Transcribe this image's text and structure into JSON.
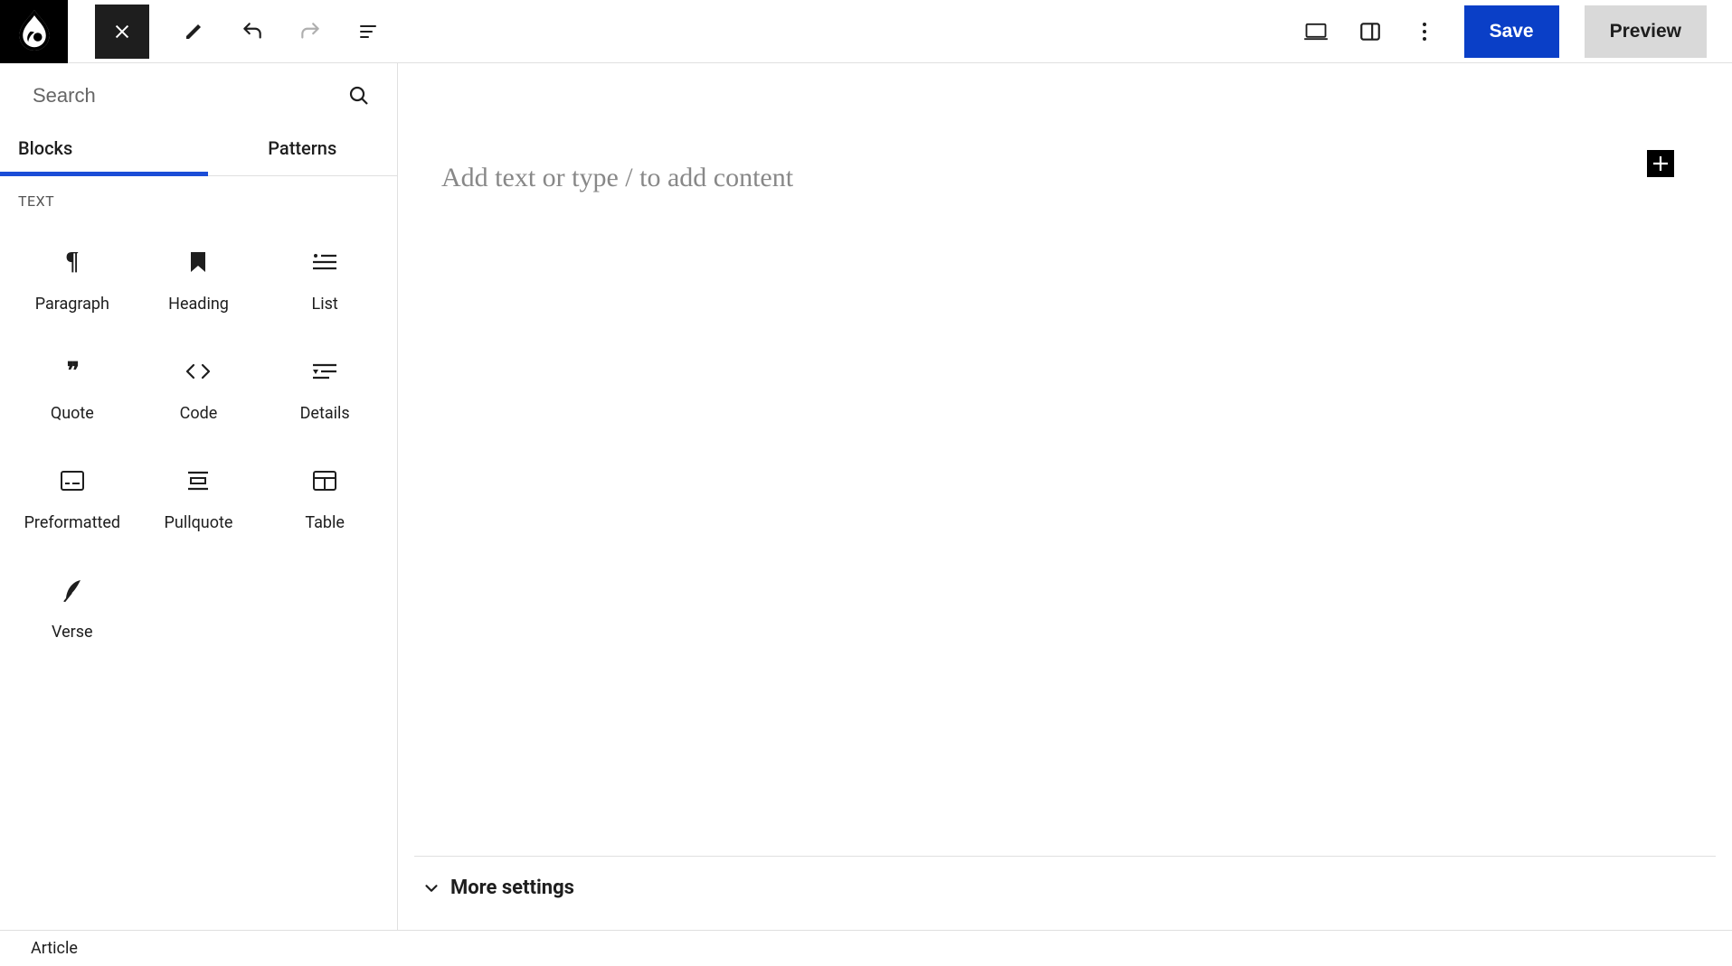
{
  "topbar": {
    "save_label": "Save",
    "preview_label": "Preview"
  },
  "sidebar": {
    "search_placeholder": "Search",
    "tabs": {
      "blocks": "Blocks",
      "patterns": "Patterns"
    },
    "section_text": "TEXT",
    "blocks": {
      "paragraph": "Paragraph",
      "heading": "Heading",
      "list": "List",
      "quote": "Quote",
      "code": "Code",
      "details": "Details",
      "preformatted": "Preformatted",
      "pullquote": "Pullquote",
      "table": "Table",
      "verse": "Verse"
    }
  },
  "canvas": {
    "placeholder": "Add text or type / to add content",
    "more_settings": "More settings"
  },
  "footer": {
    "breadcrumb": "Article"
  }
}
